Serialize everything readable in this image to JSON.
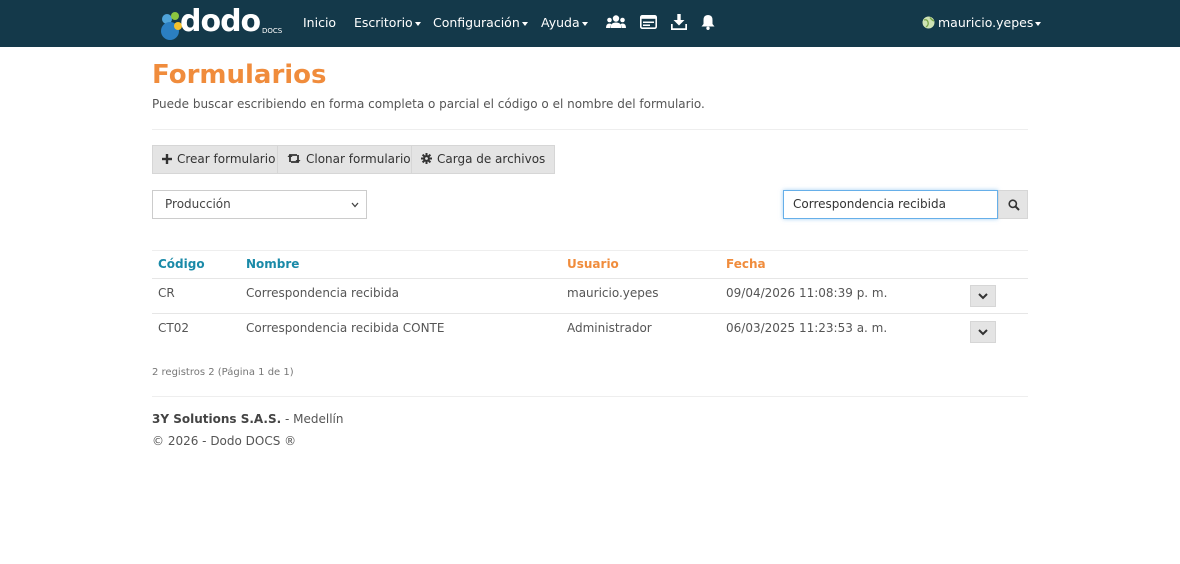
{
  "brand": {
    "logo_text": "dodo",
    "logo_sub": "DOCS"
  },
  "nav": {
    "inicio": "Inicio",
    "escritorio": "Escritorio",
    "configuracion": "Configuración",
    "ayuda": "Ayuda",
    "user": "mauricio.yepes",
    "icons": [
      "users-icon",
      "id-card-icon",
      "download-icon",
      "bell-icon"
    ]
  },
  "page": {
    "title": "Formularios",
    "subtitle": "Puede buscar escribiendo en forma completa o parcial el código o el nombre del formulario."
  },
  "toolbar": {
    "crear": "Crear formulario",
    "clonar": "Clonar formulario",
    "carga": "Carga de archivos"
  },
  "filter": {
    "environment": "Producción"
  },
  "search": {
    "value": "Correspondencia recibida"
  },
  "table": {
    "headers": {
      "codigo": "Código",
      "nombre": "Nombre",
      "usuario": "Usuario",
      "fecha": "Fecha"
    },
    "rows": [
      {
        "codigo": "CR",
        "nombre": "Correspondencia recibida",
        "usuario": "mauricio.yepes",
        "fecha": "09/04/2026 11:08:39 p. m."
      },
      {
        "codigo": "CT02",
        "nombre": "Correspondencia recibida CONTE",
        "usuario": "Administrador",
        "fecha": "06/03/2025 11:23:53 a. m."
      }
    ]
  },
  "pagination": {
    "summary": "2 registros 2 (Página 1 de 1)"
  },
  "footer": {
    "company": "3Y Solutions S.A.S.",
    "city": " - Medellín",
    "copyright": "© 2026 - Dodo DOCS ®"
  },
  "colors": {
    "navbar": "#14394a",
    "title": "#f08c3c",
    "header_blue": "#1a8aa8",
    "header_orange": "#f08c3c"
  }
}
